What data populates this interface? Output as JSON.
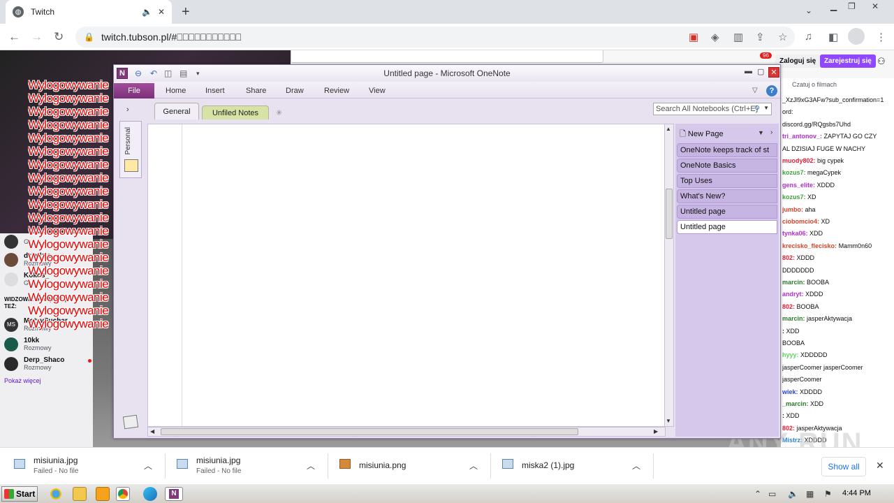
{
  "browser": {
    "tab_title": "Twitch",
    "url": "twitch.tubson.pl/#⎕⎕⎕⎕⎕⎕⎕⎕⎕⎕⎕"
  },
  "twitch": {
    "login_label": "Zaloguj się",
    "register_label": "Zarejestruj się",
    "notif_count": "96",
    "chat_title": "Czatuj o filmach",
    "overlay_line": "Wylogowywanie s",
    "sidebar": {
      "channels": [
        {
          "name": "",
          "category": "Gr"
        },
        {
          "name": "dziadzia",
          "category": "Rozmowy"
        },
        {
          "name": "Kokos_",
          "category": "Gr"
        }
      ],
      "also_watch_header": "WIDZOWIE OGLĄDAJĄ TEŻ:",
      "recommended": [
        {
          "name": "MotyvSuchar",
          "category": "Rozmowy",
          "initials": "MS"
        },
        {
          "name": "10kk",
          "category": "Rozmowy",
          "initials": ""
        },
        {
          "name": "Derp_Shaco",
          "category": "Rozmowy",
          "initials": ""
        }
      ],
      "show_more": "Pokaż więcej"
    },
    "chat_lines": [
      {
        "user": "",
        "text": "_XzJl9xG3AFw?sub_confirmation=1",
        "color": "#0e0e10"
      },
      {
        "user": "",
        "text": "ord:",
        "color": "#0e0e10"
      },
      {
        "user": "",
        "text": "discord.gg/RQgsbs7Uhd",
        "color": "#0e0e10"
      },
      {
        "user": "tri_antonov_:",
        "text": "ZAPYTAJ GO CZY",
        "color": "#b22ed1"
      },
      {
        "user": "",
        "text": "AL DZISIAJ FUGE W NACHY",
        "color": "#0e0e10"
      },
      {
        "user": "muody802:",
        "text": "big cypek",
        "color": "#e0213a"
      },
      {
        "user": "kozus7:",
        "text": "megaCypek",
        "color": "#3aa53a"
      },
      {
        "user": "gens_elite:",
        "text": "XDDD",
        "color": "#b22ed1"
      },
      {
        "user": "kozus7:",
        "text": "XD",
        "color": "#3aa53a"
      },
      {
        "user": "jumbo:",
        "text": "aha",
        "color": "#d7432a"
      },
      {
        "user": "ciobomcio4:",
        "text": "XD",
        "color": "#d7432a"
      },
      {
        "user": "tynka06:",
        "text": "XDD",
        "color": "#b22ed1"
      },
      {
        "user": "krecisko_flecisko:",
        "text": "Mamm0n60",
        "color": "#d7432a"
      },
      {
        "user": "802:",
        "text": "XDDD",
        "color": "#e0213a"
      },
      {
        "user": "",
        "text": "DDDDDDD",
        "color": "#0e0e10"
      },
      {
        "user": "marcin:",
        "text": "BOOBA",
        "color": "#2b7a2b"
      },
      {
        "user": "andryt:",
        "text": "XDDD",
        "color": "#b22ed1"
      },
      {
        "user": "802:",
        "text": "BOOBA",
        "color": "#e0213a"
      },
      {
        "user": "marcin:",
        "text": "jasperAktywacja",
        "color": "#2b7a2b"
      },
      {
        "user": ":",
        "text": "XDD",
        "color": "#0e0e10"
      },
      {
        "user": "",
        "text": "BOOBA",
        "color": "#0e0e10"
      },
      {
        "user": "hyyy:",
        "text": "XDDDDD",
        "color": "#5cd65c"
      },
      {
        "user": "",
        "text": "jasperCoomer jasperCoomer",
        "color": "#0e0e10"
      },
      {
        "user": "",
        "text": "jasperCoomer",
        "color": "#0e0e10"
      },
      {
        "user": "wiek:",
        "text": "XDDDD",
        "color": "#2a46d7"
      },
      {
        "user": "_marcin:",
        "text": "XDD",
        "color": "#2b7a2b"
      },
      {
        "user": ":",
        "text": "XDD",
        "color": "#0e0e10"
      },
      {
        "user": "802:",
        "text": "jasperAktywacja",
        "color": "#e0213a"
      },
      {
        "user": "Mistrz:",
        "text": "XDDDD",
        "color": "#2a86d7"
      },
      {
        "user": "",
        "text": "DDD",
        "color": "#0e0e10"
      }
    ]
  },
  "onenote": {
    "window_title": "Untitled page  -  Microsoft OneNote",
    "file_tab": "File",
    "ribbon_tabs": [
      "Home",
      "Insert",
      "Share",
      "Draw",
      "Review",
      "View"
    ],
    "notebook_name": "Personal",
    "sections": [
      "General",
      "Unfiled Notes"
    ],
    "search_placeholder": "Search All Notebooks (Ctrl+E)",
    "new_page_label": "New Page",
    "pages": [
      "OneNote keeps track of st",
      "OneNote Basics",
      "Top Uses",
      "What's New?",
      "Untitled page",
      "Untitled page"
    ],
    "help_label": "?"
  },
  "downloads": [
    {
      "name": "misiunia.jpg",
      "status": "Failed - No file",
      "type": "jpg"
    },
    {
      "name": "misiunia.jpg",
      "status": "Failed - No file",
      "type": "jpg"
    },
    {
      "name": "misiunia.png",
      "status": "",
      "type": "png"
    },
    {
      "name": "miska2 (1).jpg",
      "status": "",
      "type": "jpg"
    }
  ],
  "downloads_show_all": "Show all",
  "taskbar": {
    "start_label": "Start",
    "clock": "4:44 PM"
  },
  "watermark": "ANY RUN"
}
